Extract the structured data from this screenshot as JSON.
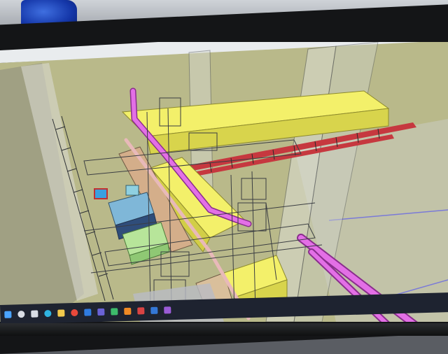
{
  "scene": {
    "description_type": "photo-of-monitor-showing-3d-model",
    "colors": {
      "model_background": "#b9b98a",
      "duct_yellow": "#f3f06a",
      "pipe_magenta": "#e36fe6",
      "cable_tray_red": "#c6383f",
      "equipment_blue": "#7fb7d8",
      "equipment_green": "#b7e59a",
      "beam_tan": "#d4ae8a",
      "taskbar": "#1e2330"
    }
  },
  "taskbar": {
    "icons": [
      {
        "name": "windows-icon",
        "color": "#4aa3ff"
      },
      {
        "name": "search-icon",
        "color": "#d9dde5"
      },
      {
        "name": "task-view-icon",
        "color": "#d9dde5"
      },
      {
        "name": "edge-icon",
        "color": "#2fb3e0"
      },
      {
        "name": "file-explorer-icon",
        "color": "#f2c94c"
      },
      {
        "name": "chrome-icon",
        "color": "#e8493b"
      },
      {
        "name": "outlook-icon",
        "color": "#2f7be0"
      },
      {
        "name": "teams-icon",
        "color": "#6a62d6"
      },
      {
        "name": "app-icon-green",
        "color": "#3dbb6b"
      },
      {
        "name": "app-icon-orange",
        "color": "#f08a24"
      },
      {
        "name": "app-icon-red",
        "color": "#d94343"
      },
      {
        "name": "app-icon-blue",
        "color": "#3477d6"
      },
      {
        "name": "app-icon-purple",
        "color": "#9a5bd6"
      }
    ]
  }
}
